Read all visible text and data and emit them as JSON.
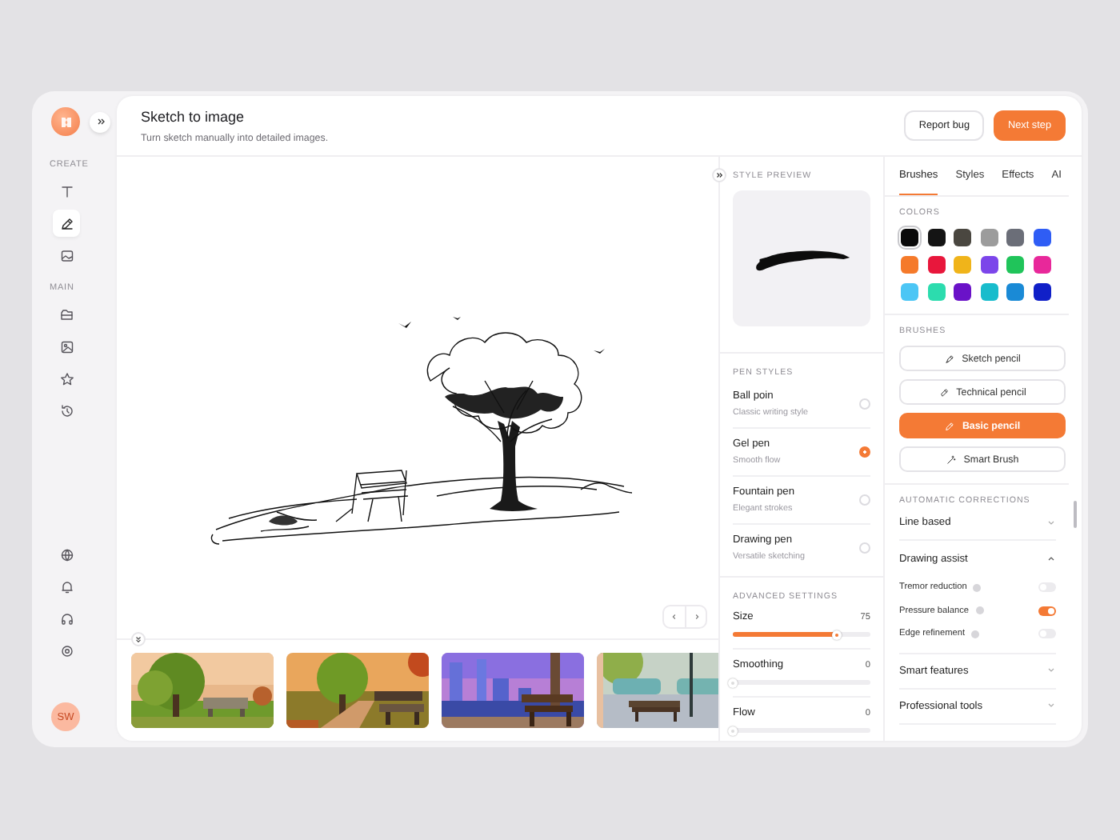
{
  "sidebar": {
    "sections": [
      {
        "label": "CREATE",
        "items": [
          {
            "selected": false
          },
          {
            "selected": true
          },
          {
            "selected": false
          }
        ]
      },
      {
        "label": "MAIN",
        "items": [
          {
            "selected": false
          },
          {
            "selected": false
          },
          {
            "selected": false
          },
          {
            "selected": false
          }
        ]
      },
      {
        "items": [
          {
            "selected": false
          },
          {
            "selected": false
          },
          {
            "selected": false
          },
          {
            "selected": false
          }
        ]
      }
    ],
    "avatar": "SW"
  },
  "header": {
    "title": "Sketch to image",
    "subtitle": "Turn sketch manually into detailed images.",
    "buttons": [
      {
        "label": "Report bug",
        "kind": "secondary"
      },
      {
        "label": "Next step",
        "kind": "primary"
      }
    ]
  },
  "style_preview": {
    "label": "STYLE PREVIEW"
  },
  "pen_styles": {
    "label": "PEN STYLES",
    "items": [
      {
        "name": "Ball poin",
        "description": "Classic writing style",
        "selected": false
      },
      {
        "name": "Gel pen",
        "description": "Smooth flow",
        "selected": true
      },
      {
        "name": "Fountain pen",
        "description": "Elegant strokes",
        "selected": false
      },
      {
        "name": "Drawing pen",
        "description": "Versatile sketching",
        "selected": false
      }
    ]
  },
  "advanced_settings": {
    "label": "ADVANCED SETTINGS",
    "sliders": [
      {
        "name": "Size",
        "reading": "75",
        "level": 0.75
      },
      {
        "name": "Smoothing",
        "reading": "0",
        "level": 0
      },
      {
        "name": "Flow",
        "reading": "0",
        "level": 0
      }
    ]
  },
  "tabs": [
    {
      "label": "Brushes",
      "selected": true
    },
    {
      "label": "Styles",
      "selected": false
    },
    {
      "label": "Effects",
      "selected": false
    },
    {
      "label": "AI",
      "selected": false
    }
  ],
  "colors": {
    "label": "COLORS",
    "swatches": [
      {
        "color": "#0a0a0a",
        "selected": true
      },
      {
        "color": "#141414",
        "selected": false
      },
      {
        "color": "#4a4740",
        "selected": false
      },
      {
        "color": "#9c9c9c",
        "selected": false
      },
      {
        "color": "#6b6e78",
        "selected": false
      },
      {
        "color": "#2f5df5",
        "selected": false
      },
      {
        "color": "#f57a2a",
        "selected": false
      },
      {
        "color": "#e8173c",
        "selected": false
      },
      {
        "color": "#f0b41a",
        "selected": false
      },
      {
        "color": "#7c45ea",
        "selected": false
      },
      {
        "color": "#20c45a",
        "selected": false
      },
      {
        "color": "#e8289a",
        "selected": false
      },
      {
        "color": "#4cc6f5",
        "selected": false
      },
      {
        "color": "#2cdcae",
        "selected": false
      },
      {
        "color": "#6a12c8",
        "selected": false
      },
      {
        "color": "#18bccc",
        "selected": false
      },
      {
        "color": "#1a8ad6",
        "selected": false
      },
      {
        "color": "#1020c8",
        "selected": false
      }
    ]
  },
  "brushes": {
    "label": "BRUSHES",
    "items": [
      {
        "label": "Sketch pencil",
        "selected": false
      },
      {
        "label": "Technical pencil",
        "selected": false
      },
      {
        "label": "Basic pencil",
        "selected": true
      },
      {
        "label": "Smart Brush",
        "selected": false
      }
    ]
  },
  "corrections": {
    "label": "AUTOMATIC CORRECTIONS",
    "sections": [
      {
        "title": "Line based",
        "expanded": false
      },
      {
        "title": "Drawing assist",
        "expanded": true,
        "options": [
          {
            "label": "Tremor reduction",
            "on": false
          },
          {
            "label": "Pressure balance",
            "on": true
          },
          {
            "label": "Edge refinement",
            "on": false
          }
        ]
      },
      {
        "title": "Smart features",
        "expanded": false
      },
      {
        "title": "Professional tools",
        "expanded": false
      }
    ]
  }
}
